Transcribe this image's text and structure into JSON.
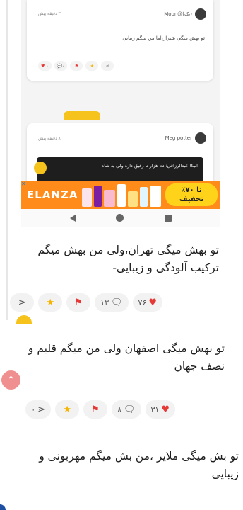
{
  "embedded": {
    "card1": {
      "time": "۳ دقیقه پیش",
      "username": "Moon@(یک)",
      "text": "تو بهش میگی شیراز،اما من میگم زیبایی",
      "likes": "۰",
      "comments": "۰"
    },
    "badge": "",
    "card2": {
      "time": "۸ دقیقه پیش",
      "username": "Meg potter",
      "quote": "الیکا عبدالرزاقی:ادم هزار تا رفیق داره ولی یه شاه"
    },
    "ad": {
      "brand": "ELANZA",
      "offer_line1": "تا ۷۰٪",
      "offer_line2": "تخفیف"
    }
  },
  "comments": [
    {
      "text": "تو بهش میگی تهران،ولی من بهش میگم ترکیب آلودگی و زیبایی-",
      "likes": "۷۶",
      "replies": "۱۳"
    },
    {
      "text": "تو بهش میگی اصفهان ولی من میگم قلبم و نصف جهان",
      "likes": "۳۱",
      "replies": "۸",
      "shares": "۰"
    },
    {
      "text": "تو بش میگی ملایر ،من بش میگم مهربونی و زیبایی"
    }
  ],
  "icons": {
    "like": "heart-icon",
    "reply": "speech-bubble-icon",
    "report": "flag-icon",
    "favorite": "star-icon",
    "share": "share-icon",
    "scroll_top": "chevron-up-icon"
  },
  "colors": {
    "accent": "#f6c21c",
    "like": "#e53935",
    "scroll_top": "#ef8f8f",
    "ad_bg": "#ff8c1a"
  }
}
